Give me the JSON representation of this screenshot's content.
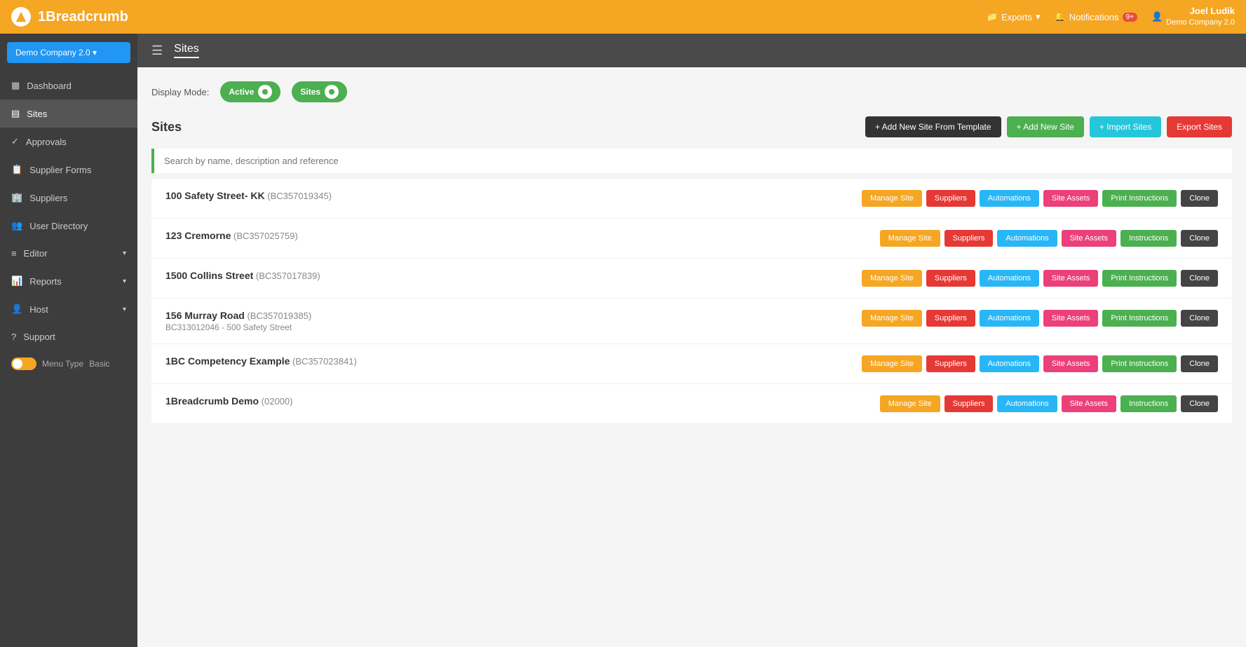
{
  "app": {
    "logo_text": "1Breadcrumb",
    "topnav": {
      "exports_label": "Exports",
      "notifications_label": "Notifications",
      "notification_count": "9+",
      "user_name": "Joel Ludik",
      "user_company": "Demo Company 2.0"
    }
  },
  "sidebar": {
    "company_btn": "Demo Company 2.0 ▾",
    "nav_items": [
      {
        "label": "Dashboard",
        "icon": "dashboard-icon"
      },
      {
        "label": "Sites",
        "icon": "sites-icon",
        "active": true
      },
      {
        "label": "Approvals",
        "icon": "approvals-icon"
      },
      {
        "label": "Supplier Forms",
        "icon": "supplier-forms-icon"
      },
      {
        "label": "Suppliers",
        "icon": "suppliers-icon"
      },
      {
        "label": "User Directory",
        "icon": "user-directory-icon"
      },
      {
        "label": "Editor",
        "icon": "editor-icon",
        "has_chevron": true
      },
      {
        "label": "Reports",
        "icon": "reports-icon",
        "has_chevron": true
      },
      {
        "label": "Host",
        "icon": "host-icon",
        "has_chevron": true
      },
      {
        "label": "Support",
        "icon": "support-icon"
      }
    ],
    "menu_type_label": "Menu Type",
    "menu_type_value": "Basic"
  },
  "sub_header": {
    "title": "Sites"
  },
  "display_mode": {
    "label": "Display Mode:",
    "toggle1_label": "Active",
    "toggle2_label": "Sites"
  },
  "sites_header": {
    "title": "Sites",
    "btn_template": "+ Add New Site From Template",
    "btn_new": "+ Add New Site",
    "btn_import": "+ Import Sites",
    "btn_export": "Export Sites"
  },
  "search": {
    "placeholder": "Search by name, description and reference"
  },
  "sites": [
    {
      "name": "100 Safety Street- KK",
      "code": "(BC357019345)",
      "sub": "",
      "actions": [
        "Manage Site",
        "Suppliers",
        "Automations",
        "Site Assets",
        "Print Instructions",
        "Clone"
      ]
    },
    {
      "name": "123 Cremorne",
      "code": "(BC357025759)",
      "sub": "",
      "actions": [
        "Manage Site",
        "Suppliers",
        "Automations",
        "Site Assets",
        "Instructions",
        "Clone"
      ]
    },
    {
      "name": "1500 Collins Street",
      "code": "(BC357017839)",
      "sub": "",
      "actions": [
        "Manage Site",
        "Suppliers",
        "Automations",
        "Site Assets",
        "Print Instructions",
        "Clone"
      ]
    },
    {
      "name": "156 Murray Road",
      "code": "(BC357019385)",
      "sub": "BC313012046 - 500 Safety Street",
      "actions": [
        "Manage Site",
        "Suppliers",
        "Automations",
        "Site Assets",
        "Print Instructions",
        "Clone"
      ]
    },
    {
      "name": "1BC Competency Example",
      "code": "(BC357023841)",
      "sub": "",
      "actions": [
        "Manage Site",
        "Suppliers",
        "Automations",
        "Site Assets",
        "Print Instructions",
        "Clone"
      ]
    },
    {
      "name": "1Breadcrumb Demo",
      "code": "(02000)",
      "sub": "",
      "actions": [
        "Manage Site",
        "Suppliers",
        "Automations",
        "Site Assets",
        "Instructions",
        "Clone"
      ]
    }
  ],
  "action_colors": {
    "Manage Site": "ab-orange",
    "Suppliers": "ab-red",
    "Automations": "ab-blue",
    "Site Assets": "ab-pink",
    "Print Instructions": "ab-green",
    "Instructions": "ab-green",
    "Clone": "ab-dark"
  }
}
